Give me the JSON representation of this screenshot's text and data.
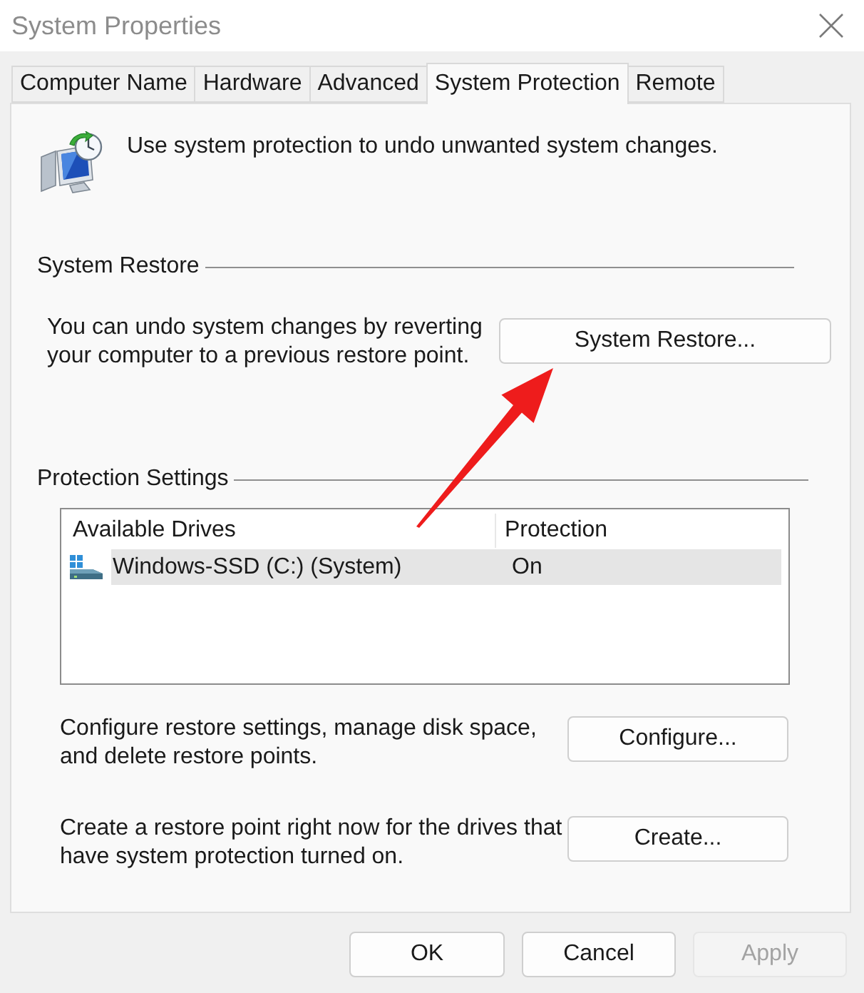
{
  "window": {
    "title": "System Properties"
  },
  "tabs": [
    {
      "label": "Computer Name",
      "selected": false
    },
    {
      "label": "Hardware",
      "selected": false
    },
    {
      "label": "Advanced",
      "selected": false
    },
    {
      "label": "System Protection",
      "selected": true
    },
    {
      "label": "Remote",
      "selected": false
    }
  ],
  "intro": {
    "text": "Use system protection to undo unwanted system changes."
  },
  "system_restore": {
    "heading": "System Restore",
    "text": "You can undo system changes by reverting your computer to a previous restore point.",
    "button": "System Restore..."
  },
  "protection_settings": {
    "heading": "Protection Settings",
    "columns": [
      "Available Drives",
      "Protection"
    ],
    "rows": [
      {
        "drive": "Windows-SSD (C:) (System)",
        "protection": "On",
        "selected": true
      }
    ],
    "actions": [
      {
        "text": "Configure restore settings, manage disk space, and delete restore points.",
        "button": "Configure..."
      },
      {
        "text": "Create a restore point right now for the drives that have system protection turned on.",
        "button": "Create..."
      }
    ]
  },
  "buttons": [
    {
      "label": "OK",
      "disabled": false
    },
    {
      "label": "Cancel",
      "disabled": false
    },
    {
      "label": "Apply",
      "disabled": true
    }
  ]
}
